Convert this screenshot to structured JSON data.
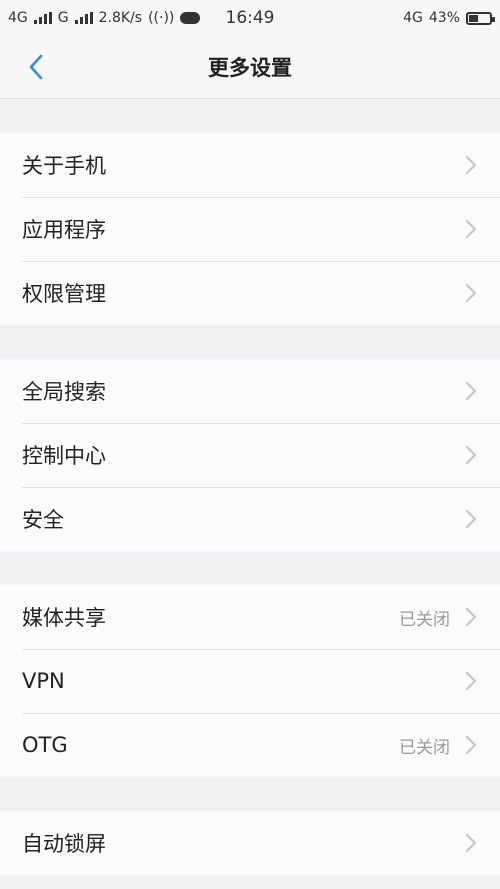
{
  "status_bar": {
    "net1": "4G",
    "net2": "G",
    "speed": "2.8K/s",
    "time": "16:49",
    "net3": "4G",
    "battery_text": "43%",
    "battery_level": 0.43
  },
  "nav": {
    "title": "更多设置",
    "back_icon": "back-chevron-icon"
  },
  "groups": [
    [
      {
        "label": "关于手机",
        "value": ""
      },
      {
        "label": "应用程序",
        "value": ""
      },
      {
        "label": "权限管理",
        "value": ""
      }
    ],
    [
      {
        "label": "全局搜索",
        "value": ""
      },
      {
        "label": "控制中心",
        "value": ""
      },
      {
        "label": "安全",
        "value": ""
      }
    ],
    [
      {
        "label": "媒体共享",
        "value": "已关闭"
      },
      {
        "label": "VPN",
        "value": ""
      },
      {
        "label": "OTG",
        "value": "已关闭"
      }
    ],
    [
      {
        "label": "自动锁屏",
        "value": ""
      }
    ]
  ],
  "colors": {
    "accent": "#2f8fe8",
    "chevron": "#c4c4c8"
  }
}
